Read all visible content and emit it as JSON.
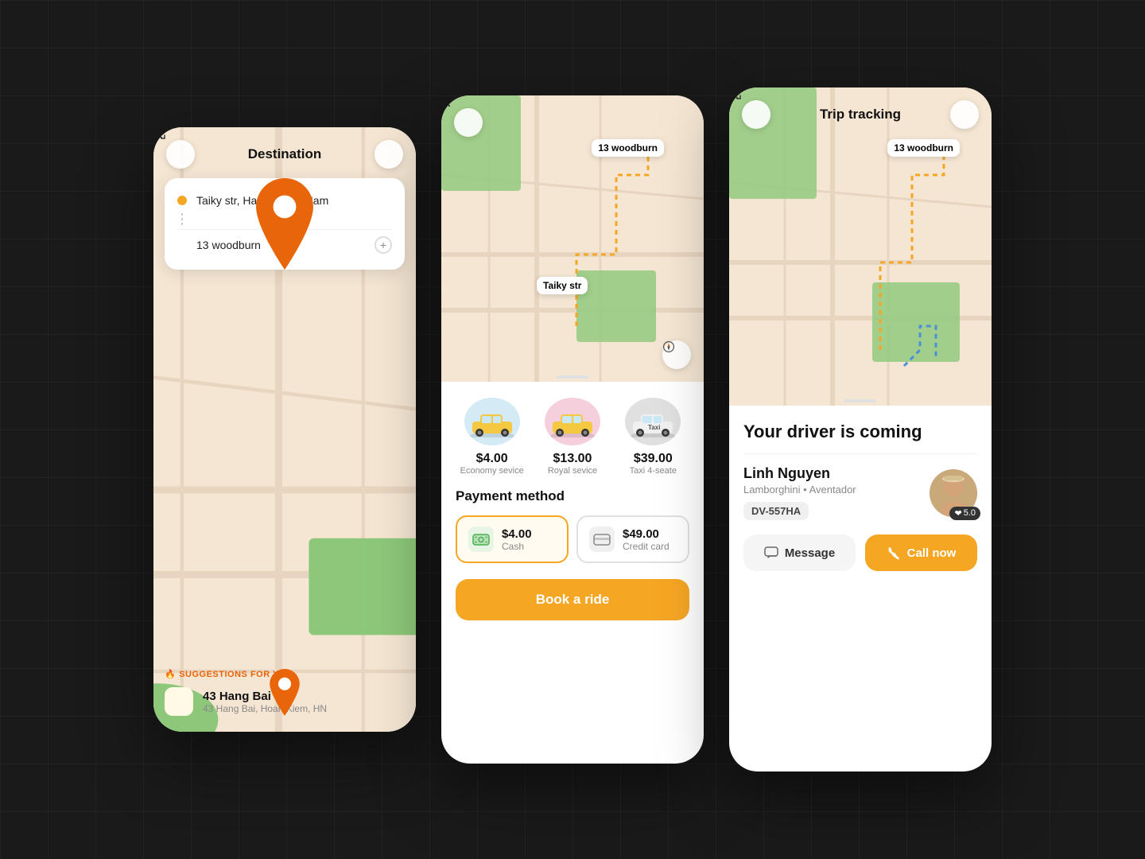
{
  "background": "#1a1a1a",
  "phone1": {
    "header": {
      "title": "Destination",
      "back_icon": "chevron-left",
      "expand_icon": "expand"
    },
    "location": {
      "from": "Taiky str, Ha Noi, Viet Nam",
      "to": "13 woodburn"
    },
    "suggestions_label": "SUGGESTIONS FOR YOU",
    "suggestion": {
      "name": "43 Hang Bai",
      "address": "43 Hang Bai, Hoan Kiem, HN"
    }
  },
  "phone2": {
    "map": {
      "label_from": "Taiky str",
      "label_to": "13 woodburn"
    },
    "rides": [
      {
        "price": "$4.00",
        "name": "Economy sevice",
        "bg": "#d4eaf5"
      },
      {
        "price": "$13.00",
        "name": "Royal sevice",
        "bg": "#f5d0dc"
      },
      {
        "price": "$39.00",
        "name": "Taxi 4-seate",
        "bg": "#e0e0e0"
      }
    ],
    "payment_title": "Payment method",
    "payment_options": [
      {
        "label": "$4.00",
        "sublabel": "Cash",
        "active": true
      },
      {
        "label": "$49.00",
        "sublabel": "Credit card",
        "active": false
      }
    ],
    "book_button": "Book a ride"
  },
  "phone3": {
    "header": {
      "title": "Trip tracking",
      "back_icon": "chevron-left",
      "expand_icon": "expand"
    },
    "map": {
      "label_to": "13 woodburn"
    },
    "driver_section": {
      "title": "Your driver is coming",
      "driver_name": "Linh Nguyen",
      "car_model": "Lamborghini • Aventador",
      "plate": "DV-557HA",
      "rating": "5.0"
    },
    "buttons": {
      "message": "Message",
      "call": "Call now"
    }
  }
}
